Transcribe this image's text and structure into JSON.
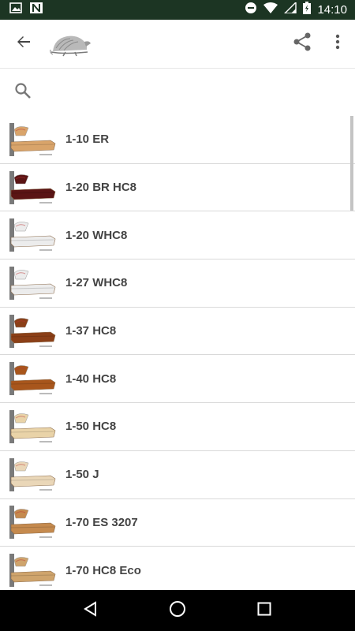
{
  "status_bar": {
    "time": "14:10",
    "left_icons": [
      "image-icon",
      "n-icon"
    ],
    "right_icons": [
      "dnd-icon",
      "wifi-icon",
      "signal-icon",
      "battery-icon"
    ]
  },
  "toolbar": {
    "back_icon": "arrow-back-icon",
    "logo": "armadillo-logo",
    "share_icon": "share-icon",
    "more_icon": "more-vert-icon"
  },
  "search": {
    "value": "",
    "placeholder": ""
  },
  "items": [
    {
      "label": "1-10 ER",
      "color": "#d9a46a"
    },
    {
      "label": "1-20 BR HC8",
      "color": "#5a1414"
    },
    {
      "label": "1-20 WHC8",
      "color": "#ececec"
    },
    {
      "label": "1-27 WHC8",
      "color": "#ececec"
    },
    {
      "label": "1-37 HC8",
      "color": "#8b3f17"
    },
    {
      "label": "1-40 HC8",
      "color": "#a8561c"
    },
    {
      "label": "1-50 HC8",
      "color": "#e9d3a8"
    },
    {
      "label": "1-50 J",
      "color": "#ead7b8"
    },
    {
      "label": "1-70 ES 3207",
      "color": "#c58a4e"
    },
    {
      "label": "1-70 HC8 Eco",
      "color": "#cfa46c"
    }
  ],
  "colors": {
    "status_bar": "#1c3523",
    "text": "#444444",
    "divider": "#d9d9d9"
  }
}
